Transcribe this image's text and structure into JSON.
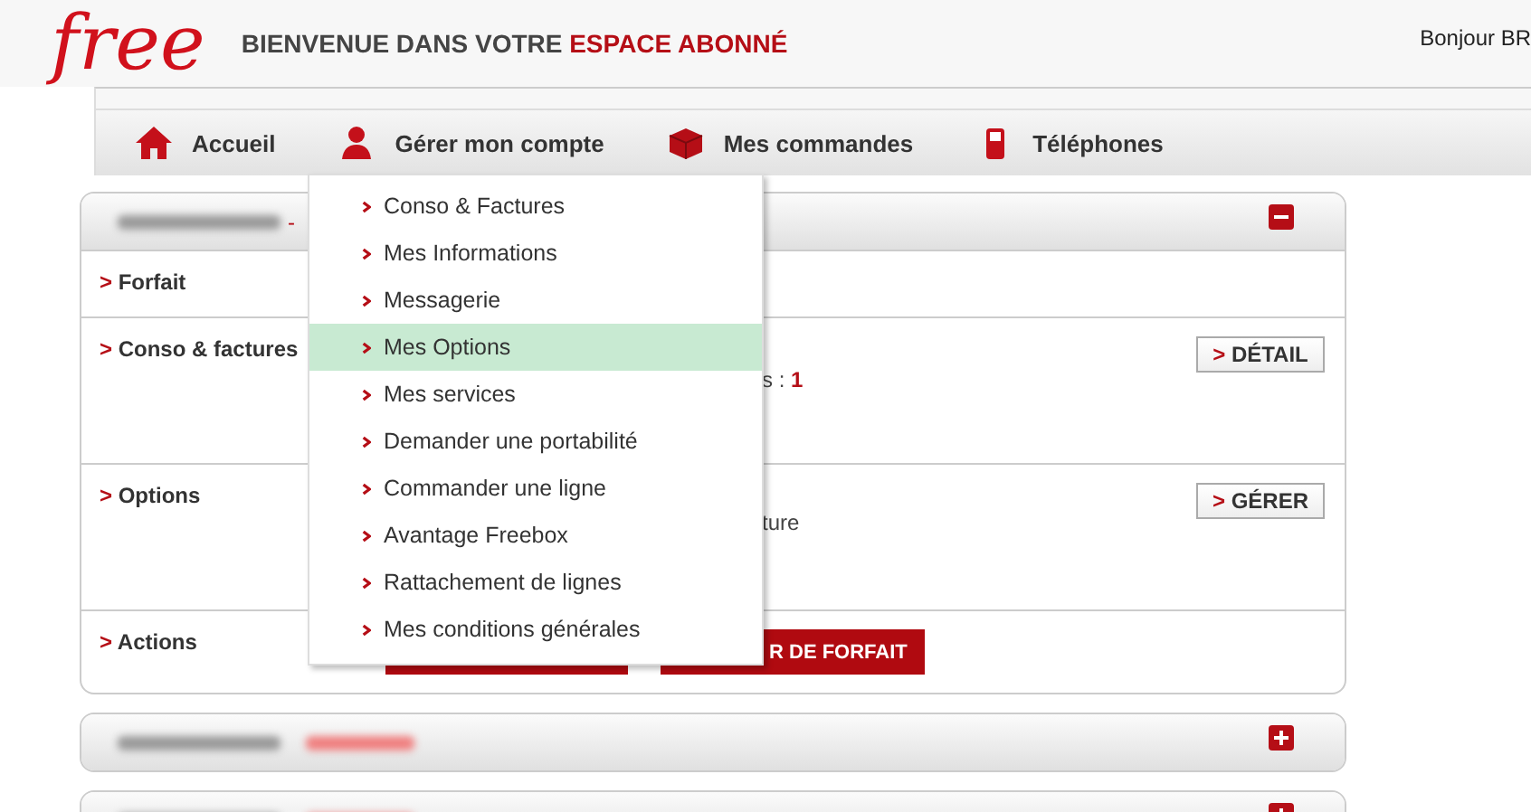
{
  "header": {
    "logo": "free",
    "title": "BIENVENUE DANS VOTRE",
    "title_highlight": "ESPACE ABONNÉ",
    "greeting": "Bonjour BR"
  },
  "nav": [
    {
      "label": "Accueil"
    },
    {
      "label": "Gérer mon compte"
    },
    {
      "label": "Mes commandes"
    },
    {
      "label": "Téléphones"
    }
  ],
  "dropdown": [
    {
      "label": "Conso & Factures",
      "selected": false
    },
    {
      "label": "Mes Informations",
      "selected": false
    },
    {
      "label": "Messagerie",
      "selected": false
    },
    {
      "label": "Mes Options",
      "selected": true
    },
    {
      "label": "Mes services",
      "selected": false
    },
    {
      "label": "Demander une portabilité",
      "selected": false
    },
    {
      "label": "Commander une ligne",
      "selected": false
    },
    {
      "label": "Avantage Freebox",
      "selected": false
    },
    {
      "label": "Rattachement de lignes",
      "selected": false
    },
    {
      "label": "Mes conditions générales",
      "selected": false
    }
  ],
  "accounts": [
    {
      "suffix": "-",
      "expanded": true,
      "rows": [
        {
          "kind": "plain",
          "marker": ">",
          "label": "Forfait"
        },
        {
          "kind": "info",
          "marker": ">",
          "label": "Conso & factures",
          "text": "s :",
          "value": "1",
          "button": {
            "marker": ">",
            "label": "DÉTAIL"
          }
        },
        {
          "kind": "info",
          "marker": ">",
          "label": "Options",
          "text": "ture",
          "button": {
            "marker": ">",
            "label": "GÉRER"
          }
        },
        {
          "kind": "actions",
          "marker": ">",
          "label": "Actions",
          "buttons": [
            {
              "kind": "covered"
            },
            {
              "kind": "labeled",
              "label": "R DE FORFAIT"
            }
          ]
        }
      ]
    },
    {
      "expanded": false
    },
    {
      "expanded": false
    }
  ]
}
